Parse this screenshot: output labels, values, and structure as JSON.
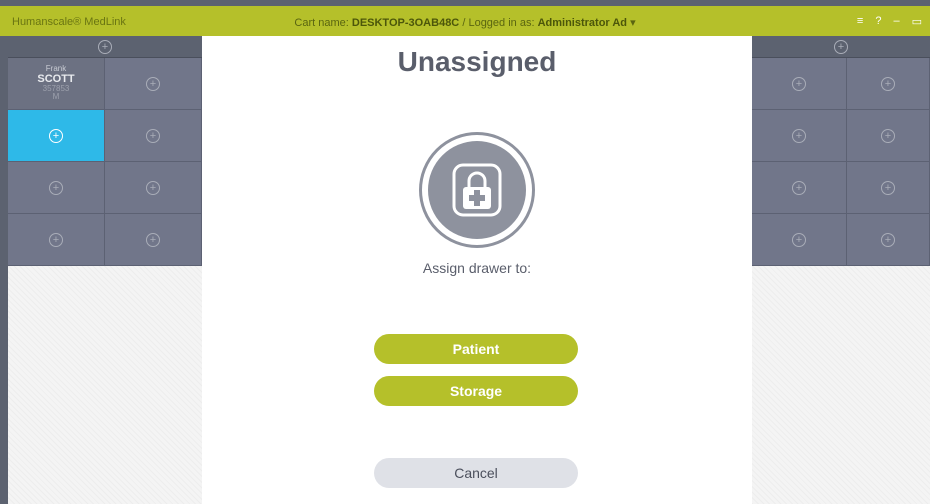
{
  "titlebar": {
    "app_name": "Humanscale® MedLink",
    "cart_label": "Cart name:",
    "cart_name": "DESKTOP-3OAB48C",
    "separator": "/",
    "logged_label": "Logged in as:",
    "user_name": "Administrator Ad",
    "user_caret": "▾",
    "controls": [
      "≡",
      "?",
      "–",
      "▭"
    ]
  },
  "left_panel": {
    "header_icon": "plus-circle-icon",
    "patient": {
      "first_name": "Frank",
      "last_name": "SCOTT",
      "id": "357853",
      "sex": "M"
    },
    "active_cell": 2
  },
  "modal": {
    "title": "Unassigned",
    "icon": "lock-medical-icon",
    "assign_label": "Assign drawer to:",
    "patient_button": "Patient",
    "storage_button": "Storage",
    "cancel_button": "Cancel"
  },
  "colors": {
    "accent": "#b5c02a",
    "selected_cell": "#2eb9e8",
    "cell": "#71768a",
    "frame": "#5c6270"
  }
}
